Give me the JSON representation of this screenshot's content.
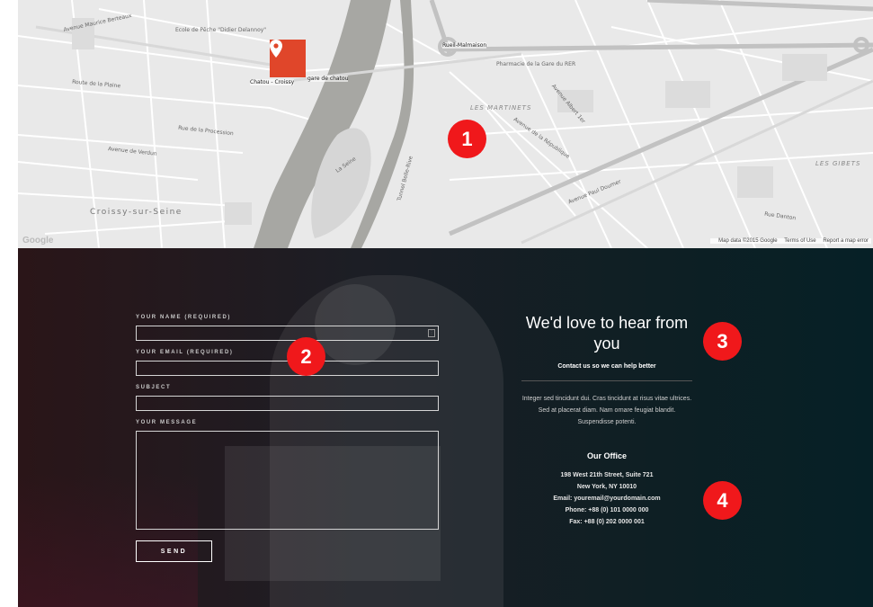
{
  "map": {
    "labels": {
      "croissy": "Croissy-sur-Seine",
      "martinets": "LES MARTINETS",
      "gibets": "LES GIBETS",
      "seine": "La Seine",
      "tunnel": "Tunnel Belle-Rive",
      "station_chatou": "Chatou - Croissy",
      "station_garde": "gare de chatou",
      "station_rueil": "Rueil-Malmaison",
      "pharmacie": "Pharmacie de la Gare du RER",
      "ecole": "Ecole de Pêche \"Didier Delannoy\"",
      "av_maurice": "Avenue Maurice Berteaux",
      "av_republique": "Avenue de la République",
      "av_albert": "Avenue Albert 1er",
      "av_doumer": "Avenue Paul Doumer",
      "route_plaine": "Route de la Plaine",
      "rue_procession": "Rue de la Procession",
      "av_verdun": "Avenue de Verdun",
      "rue_danton": "Rue Danton"
    },
    "google_logo": "Google",
    "footer": {
      "data": "Map data ©2015 Google",
      "terms": "Terms of Use",
      "report": "Report a map error"
    }
  },
  "form": {
    "name_label": "YOUR NAME (REQUIRED)",
    "email_label": "YOUR EMAIL (REQUIRED)",
    "subject_label": "SUBJECT",
    "message_label": "YOUR MESSAGE",
    "name_value": "",
    "email_value": "",
    "subject_value": "",
    "send_label": "SEND"
  },
  "info": {
    "heading": "We'd love to hear from you",
    "subheading": "Contact us so we can help better",
    "body": "Integer sed tincidunt dui. Cras tincidunt at risus vitae ultrices. Sed at placerat diam. Nam ornare feugiat blandit. Suspendisse potenti.",
    "office_title": "Our Office",
    "address1": "198  West 21th Street, Suite 721",
    "address2": "New York, NY 10010",
    "email": "Email: youremail@yourdomain.com",
    "phone": "Phone: +88 (0) 101 0000 000",
    "fax": "Fax: +88 (0) 202 0000 001"
  },
  "badges": [
    "1",
    "2",
    "3",
    "4"
  ],
  "colors": {
    "pin": "#e0462a",
    "badge": "#f0181b"
  },
  "icons": {
    "pin": "map-pin-icon"
  }
}
